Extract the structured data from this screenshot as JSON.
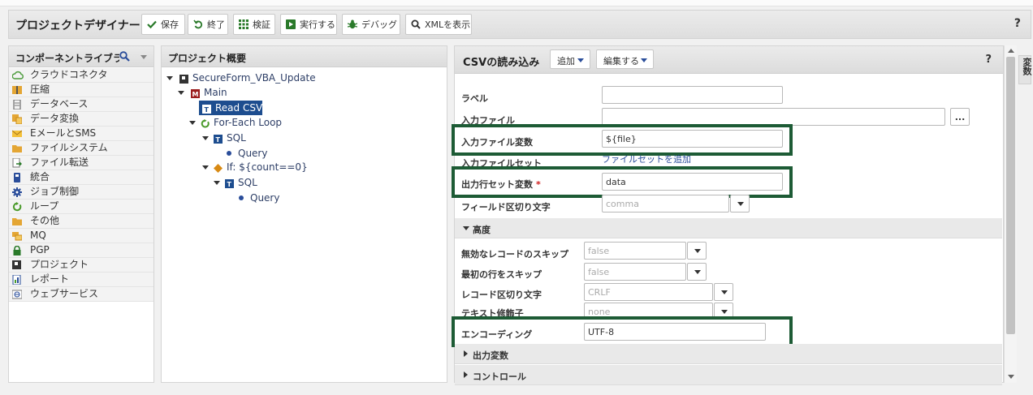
{
  "header": {
    "title": "プロジェクトデザイナー",
    "buttons": {
      "save": "保存",
      "exit": "終了",
      "validate": "検証",
      "run": "実行する",
      "debug": "デバッグ",
      "show_xml": "XMLを表示"
    },
    "help": "?"
  },
  "library": {
    "title": "コンポーネントライブラリ",
    "items": [
      {
        "label": "クラウドコネクタ",
        "icon": "cloud-icon"
      },
      {
        "label": "圧縮",
        "icon": "compress-icon"
      },
      {
        "label": "データベース",
        "icon": "database-icon"
      },
      {
        "label": "データ変換",
        "icon": "transform-icon"
      },
      {
        "label": "EメールとSMS",
        "icon": "mail-icon"
      },
      {
        "label": "ファイルシステム",
        "icon": "folder-icon"
      },
      {
        "label": "ファイル転送",
        "icon": "file-transfer-icon"
      },
      {
        "label": "統合",
        "icon": "integration-icon"
      },
      {
        "label": "ジョブ制御",
        "icon": "gear-icon"
      },
      {
        "label": "ループ",
        "icon": "loop-icon"
      },
      {
        "label": "その他",
        "icon": "folder-icon"
      },
      {
        "label": "MQ",
        "icon": "mq-icon"
      },
      {
        "label": "PGP",
        "icon": "lock-icon"
      },
      {
        "label": "プロジェクト",
        "icon": "project-icon"
      },
      {
        "label": "レポート",
        "icon": "report-icon"
      },
      {
        "label": "ウェブサービス",
        "icon": "web-service-icon"
      }
    ]
  },
  "tree": {
    "title": "プロジェクト概要",
    "project": "SecureForm_VBA_Update",
    "main": "Main",
    "read_csv": "Read CSV",
    "loop": "For-Each Loop",
    "sql1": "SQL",
    "query1": "Query",
    "if": "If: ${count==0}",
    "sql2": "SQL",
    "query2": "Query"
  },
  "form": {
    "title": "CSVの読み込み",
    "add_menu": "追加",
    "edit_menu": "編集する",
    "help": "?",
    "side_tab": "変数",
    "label": {
      "label": "ラベル",
      "value": ""
    },
    "input_file": {
      "label": "入力ファイル",
      "value": "",
      "browse": "..."
    },
    "input_file_var": {
      "label": "入力ファイル変数",
      "value": "${file}"
    },
    "input_fileset": {
      "label": "入力ファイルセット",
      "link": "ファイルセットを追加"
    },
    "output_rowset_var": {
      "label": "出力行セット変数",
      "required": "*",
      "value": "data"
    },
    "field_delimiter": {
      "label": "フィールド区切り文字",
      "value": "comma"
    },
    "advanced": "高度",
    "skip_invalid": {
      "label": "無効なレコードのスキップ",
      "value": "false"
    },
    "skip_first": {
      "label": "最初の行をスキップ",
      "value": "false"
    },
    "record_delimiter": {
      "label": "レコード区切り文字",
      "value": "CRLF"
    },
    "text_qualifier": {
      "label": "テキスト修飾子",
      "value": "none"
    },
    "encoding": {
      "label": "エンコーディング",
      "value": "UTF-8"
    },
    "output_vars": "出力変数",
    "control": "コントロール"
  },
  "colors": {
    "highlight": "#1d5b35",
    "required": "#d01c1c",
    "link": "#2a4d9a",
    "selection": "#1d4d8f"
  }
}
